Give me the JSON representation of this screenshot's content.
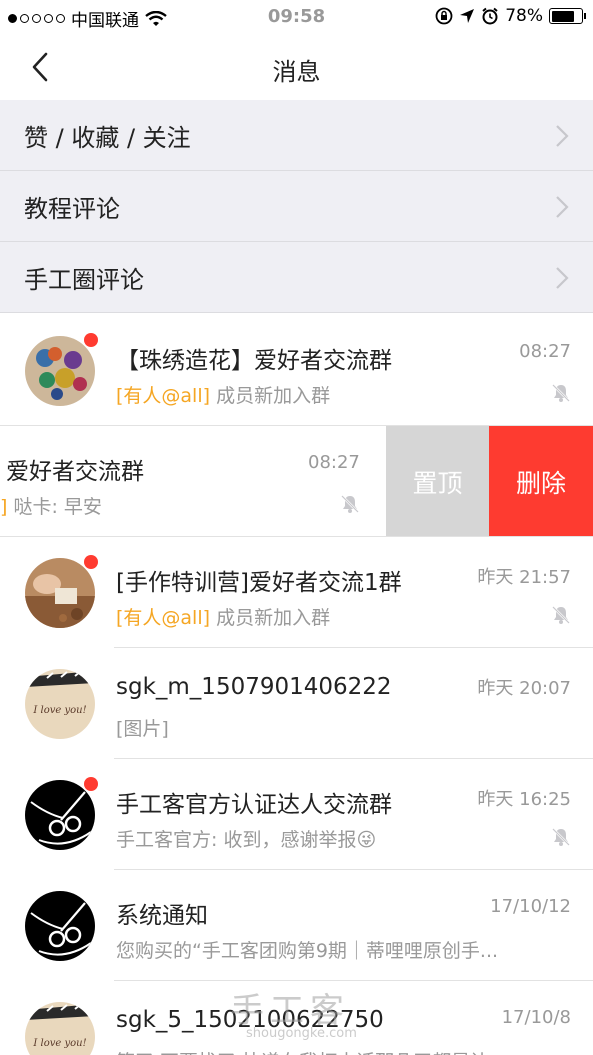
{
  "status_bar": {
    "carrier": "中国联通",
    "time": "09:58",
    "battery": "78%",
    "battery_level": 0.78,
    "icons": [
      "signal-dots-icon",
      "wifi-icon",
      "orientation-lock-icon",
      "location-arrow-icon",
      "alarm-icon",
      "battery-icon"
    ]
  },
  "nav": {
    "title": "消息",
    "back_icon": "chevron-left-icon"
  },
  "menu": [
    {
      "label": "赞 / 收藏 / 关注"
    },
    {
      "label": "教程评论"
    },
    {
      "label": "手工圈评论"
    }
  ],
  "conversations": [
    {
      "name": "【珠绣造花】爱好者交流群",
      "time": "08:27",
      "at": "[有人@all]",
      "preview": " 成员新加入群",
      "unread": true,
      "muted": true,
      "avatar": "butterfly-embroidery-avatar"
    },
    {
      "name": "爱好者交流群",
      "time": "08:27",
      "at": "]",
      "preview": " 哒卡: 早安",
      "unread": false,
      "muted": true,
      "swiped": true,
      "actions": {
        "pin": "置顶",
        "delete": "删除"
      }
    },
    {
      "name": "[手作特训营]爱好者交流1群",
      "time": "昨天 21:57",
      "at": "[有人@all]",
      "preview": " 成员新加入群",
      "unread": true,
      "muted": true,
      "avatar": "woodcraft-avatar"
    },
    {
      "name": "sgk_m_1507901406222",
      "time": "昨天 20:07",
      "at": "",
      "preview": "[图片]",
      "unread": false,
      "muted": false,
      "avatar": "i-love-you-card-avatar",
      "avatar_text": "I love you!"
    },
    {
      "name": "手工客官方认证达人交流群",
      "time": "昨天 16:25",
      "at": "",
      "preview": "手工客官方: 收到，感谢举报😜",
      "unread": true,
      "muted": true,
      "avatar": "scissors-logo-avatar"
    },
    {
      "name": "系统通知",
      "time": "17/10/12",
      "at": "",
      "preview": "您购买的“手工客团购第9期｜蒂哩哩原创手...",
      "unread": false,
      "muted": false,
      "avatar": "scissors-logo-avatar"
    },
    {
      "name": "sgk_5_1502100622750",
      "time": "17/10/8",
      "at": "",
      "preview": "等了 不要找了 快递在我打电话那几天都是让",
      "unread": false,
      "muted": false,
      "avatar": "i-love-you-card-avatar",
      "avatar_text": "I love you!"
    }
  ],
  "watermark": {
    "text": "手工客",
    "sub": "shougongke.com"
  },
  "colors": {
    "unread_dot": "#ff3b30",
    "at_mention": "#f5a623",
    "delete": "#fe3b30",
    "pin": "#d6d6d6",
    "menu_bg": "#efeff4"
  }
}
